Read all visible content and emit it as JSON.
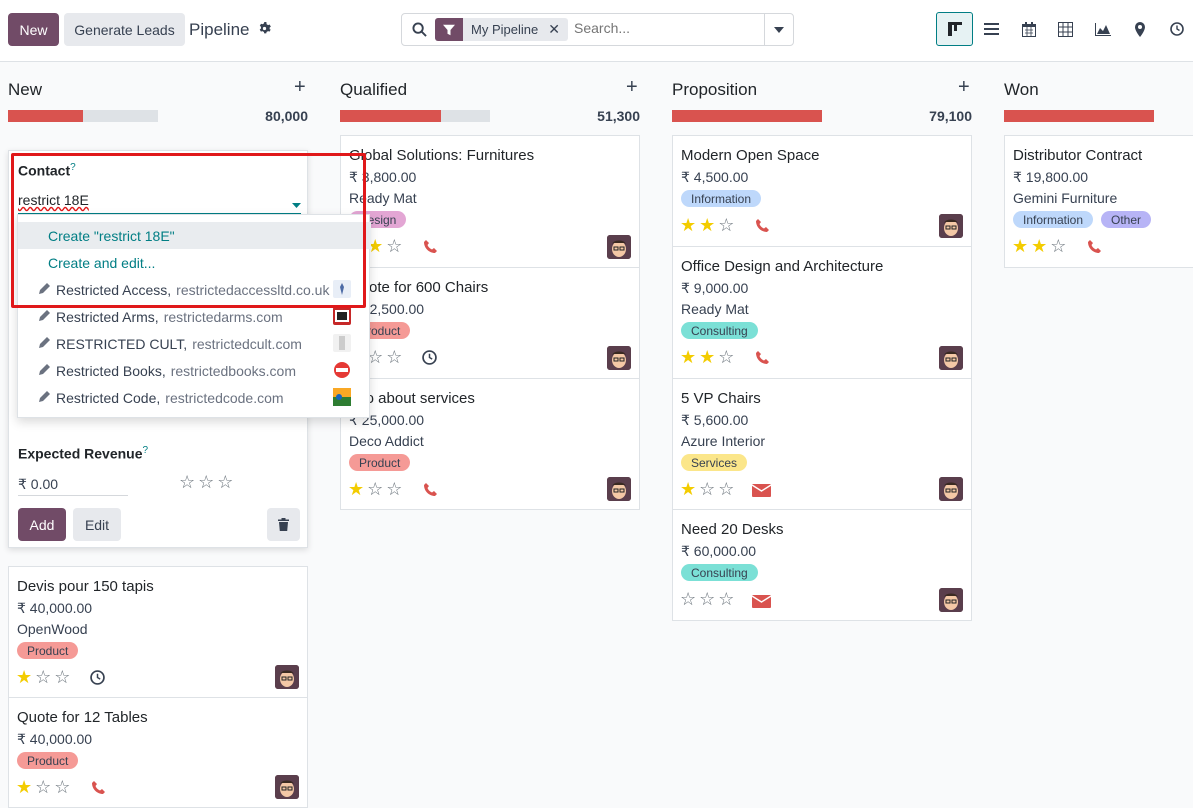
{
  "header": {
    "new_label": "New",
    "generate_label": "Generate Leads",
    "title": "Pipeline"
  },
  "search": {
    "facet": "My Pipeline",
    "placeholder": "Search..."
  },
  "columns": [
    {
      "name": "New",
      "total": "80,000",
      "progress": 0.5
    },
    {
      "name": "Qualified",
      "total": "51,300",
      "progress": 0.67
    },
    {
      "name": "Proposition",
      "total": "79,100",
      "progress": 1.0
    },
    {
      "name": "Won",
      "total": "",
      "progress": 1.0
    }
  ],
  "quick_create": {
    "contact_label": "Contact",
    "contact_value": "restrict 18E",
    "revenue_label": "Expected Revenue",
    "revenue_value": "₹ 0.00",
    "add_label": "Add",
    "edit_label": "Edit"
  },
  "autocomplete": [
    {
      "kind": "create",
      "text": "Create \"restrict 18E\""
    },
    {
      "kind": "create",
      "text": "Create and edit..."
    },
    {
      "kind": "record",
      "name": "Restricted Access,",
      "site": "restrictedaccessltd.co.uk"
    },
    {
      "kind": "record",
      "name": "Restricted Arms,",
      "site": "restrictedarms.com"
    },
    {
      "kind": "record",
      "name": "RESTRICTED CULT,",
      "site": "restrictedcult.com"
    },
    {
      "kind": "record",
      "name": "Restricted Books,",
      "site": "restrictedbooks.com"
    },
    {
      "kind": "record",
      "name": "Restricted Code,",
      "site": "restrictedcode.com"
    }
  ],
  "cards_new": [
    {
      "title": "Devis pour 150 tapis",
      "amount": "₹ 40,000.00",
      "company": "OpenWood",
      "tag": "Product",
      "stars": 1,
      "activity": "clock"
    },
    {
      "title": "Quote for 12 Tables",
      "amount": "₹ 40,000.00",
      "company": "",
      "tag": "Product",
      "stars": 1,
      "activity": "phone"
    }
  ],
  "cards_qualified": [
    {
      "title": "Global Solutions: Furnitures",
      "amount": "₹ 3,800.00",
      "company": "Ready Mat",
      "tag": "Design",
      "stars": 1,
      "activity": "phone"
    },
    {
      "title": "Quote for 600 Chairs",
      "amount": "₹ 22,500.00",
      "company": "",
      "tag": "Product",
      "stars": 0,
      "activity": "clock"
    },
    {
      "title": "Info about services",
      "amount": "₹ 25,000.00",
      "company": "Deco Addict",
      "tag": "Product",
      "stars": 1,
      "activity": "phone"
    }
  ],
  "cards_proposition": [
    {
      "title": "Modern Open Space",
      "amount": "₹ 4,500.00",
      "company": "",
      "tag": "Information",
      "stars": 2,
      "activity": "phone"
    },
    {
      "title": "Office Design and Architecture",
      "amount": "₹ 9,000.00",
      "company": "Ready Mat",
      "tag": "Consulting",
      "stars": 2,
      "activity": "phone"
    },
    {
      "title": "5 VP Chairs",
      "amount": "₹ 5,600.00",
      "company": "Azure Interior",
      "tag": "Services",
      "stars": 1,
      "activity": "mail"
    },
    {
      "title": "Need 20 Desks",
      "amount": "₹ 60,000.00",
      "company": "",
      "tag": "Consulting",
      "stars": 0,
      "activity": "mail"
    }
  ],
  "cards_won": [
    {
      "title": "Distributor Contract",
      "amount": "₹ 19,800.00",
      "company": "Gemini Furniture",
      "tags": [
        "Information",
        "Other"
      ],
      "stars": 2,
      "activity": "phone"
    }
  ],
  "colors": {
    "brand": "#714b67",
    "accent": "#017e84",
    "progress": "#d9534f",
    "highlight": "#e0181a"
  }
}
